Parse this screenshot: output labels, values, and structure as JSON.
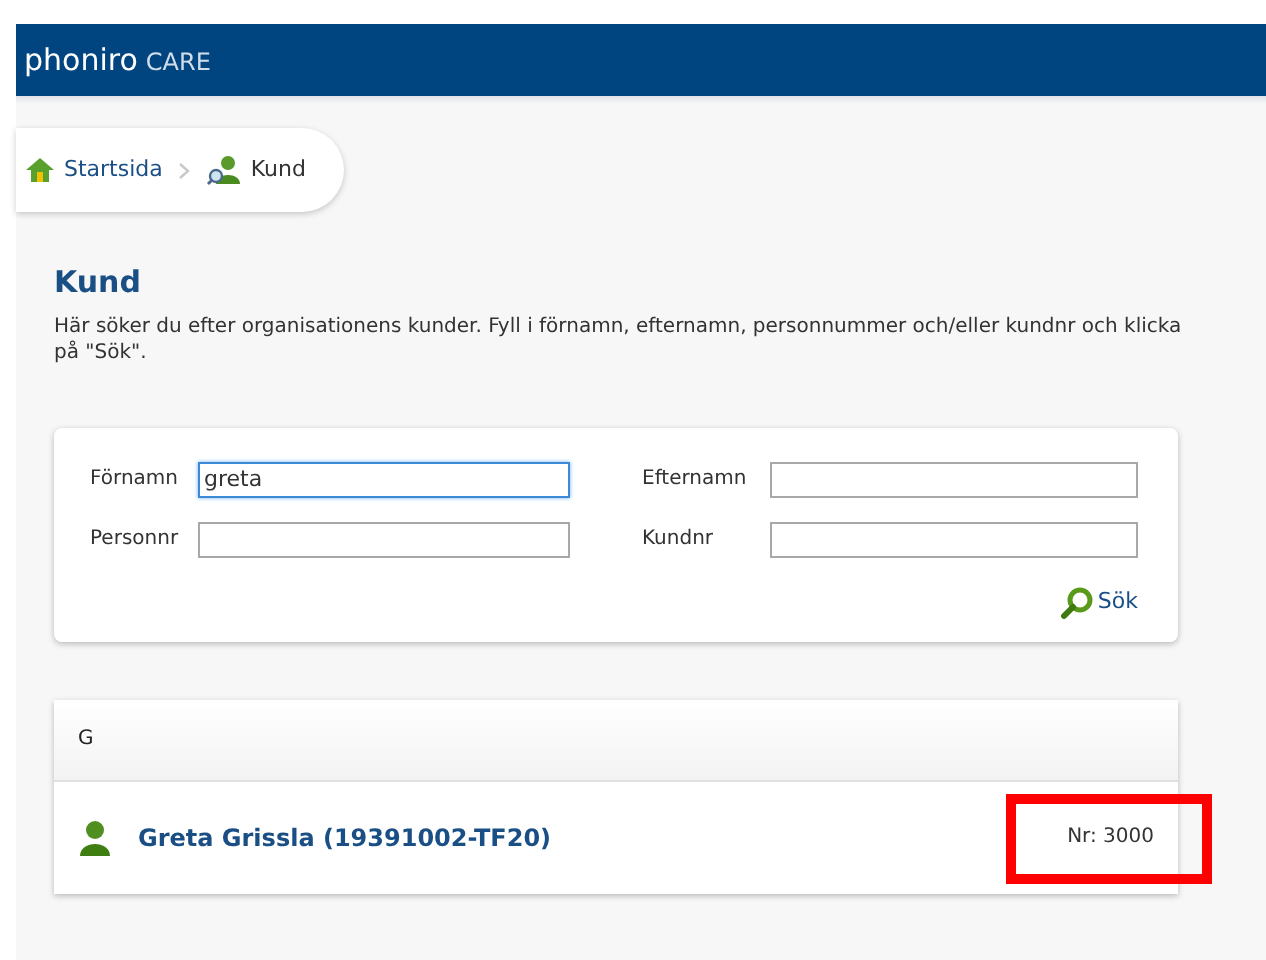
{
  "header": {
    "brand": "phoniro",
    "product": "CARE"
  },
  "breadcrumb": [
    {
      "label": "Startsida",
      "kind": "home"
    },
    {
      "label": "Kund",
      "kind": "customer"
    }
  ],
  "page": {
    "title": "Kund",
    "description": "Här söker du efter organisationens kunder. Fyll i förnamn, efternamn, personnummer och/eller kundnr och klicka på \"Sök\"."
  },
  "search_form": {
    "fields": [
      {
        "label": "Förnamn",
        "value": "greta",
        "focused": true
      },
      {
        "label": "Efternamn",
        "focused": false
      },
      {
        "label": "Personnr",
        "focused": false
      },
      {
        "label": "Kundnr",
        "focused": false
      }
    ],
    "search_button": "Sök"
  },
  "results": {
    "group": "G",
    "rows": [
      {
        "name": "Greta Grissla (19391002-TF20)",
        "number": "Nr: 3000",
        "highlighted": true
      }
    ]
  }
}
